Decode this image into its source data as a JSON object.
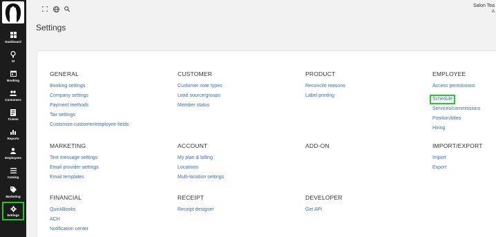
{
  "sidebar": {
    "items": [
      {
        "label": "Dashboard",
        "icon": "dashboard-icon"
      },
      {
        "label": "SI",
        "icon": "bulb-icon"
      },
      {
        "label": "Booking",
        "icon": "calendar-icon"
      },
      {
        "label": "Customers",
        "icon": "people-icon"
      },
      {
        "label": "Tickets",
        "icon": "ticket-icon"
      },
      {
        "label": "Reports",
        "icon": "bar-chart-icon"
      },
      {
        "label": "Employees",
        "icon": "person-icon"
      },
      {
        "label": "Catalog",
        "icon": "list-icon"
      },
      {
        "label": "Marketing",
        "icon": "tag-icon"
      },
      {
        "label": "Settings",
        "icon": "gear-icon",
        "active": true
      }
    ]
  },
  "topbar": {
    "user_name": "Salon Tea",
    "user_sub": "A"
  },
  "page": {
    "title": "Settings"
  },
  "sections": {
    "general": {
      "title": "GENERAL",
      "links": [
        "Booking settings",
        "Company settings",
        "Payment methods",
        "Tax settings",
        "Customize customer/employee fields"
      ]
    },
    "customer": {
      "title": "CUSTOMER",
      "links": [
        "Customer note types",
        "Lead source/groups",
        "Member status"
      ]
    },
    "product": {
      "title": "PRODUCT",
      "links": [
        "Reconcile reasons",
        "Label printing"
      ]
    },
    "employee": {
      "title": "EMPLOYEE",
      "links": [
        "Access permissions",
        "Schedule",
        "Services/commissions",
        "Position/titles",
        "Hiring"
      ]
    },
    "marketing": {
      "title": "MARKETING",
      "links": [
        "Text message settings",
        "Email provider settings",
        "Email templates"
      ]
    },
    "account": {
      "title": "ACCOUNT",
      "links": [
        "My plan & billing",
        "Locations",
        "Multi-location settings"
      ]
    },
    "addon": {
      "title": "ADD-ON",
      "links": []
    },
    "import_export": {
      "title": "IMPORT/EXPORT",
      "links": [
        "Import",
        "Export"
      ]
    },
    "financial": {
      "title": "FINANCIAL",
      "links": [
        "QuickBooks",
        "ACH",
        "Notification center"
      ]
    },
    "receipt": {
      "title": "RECEIPT",
      "links": [
        "Receipt designer"
      ]
    },
    "developer": {
      "title": "DEVELOPER",
      "links": [
        "Get API"
      ]
    }
  },
  "colors": {
    "sidebar_bg": "#1c1c1c",
    "link": "#3a6db8",
    "highlight": "#22cc22"
  }
}
